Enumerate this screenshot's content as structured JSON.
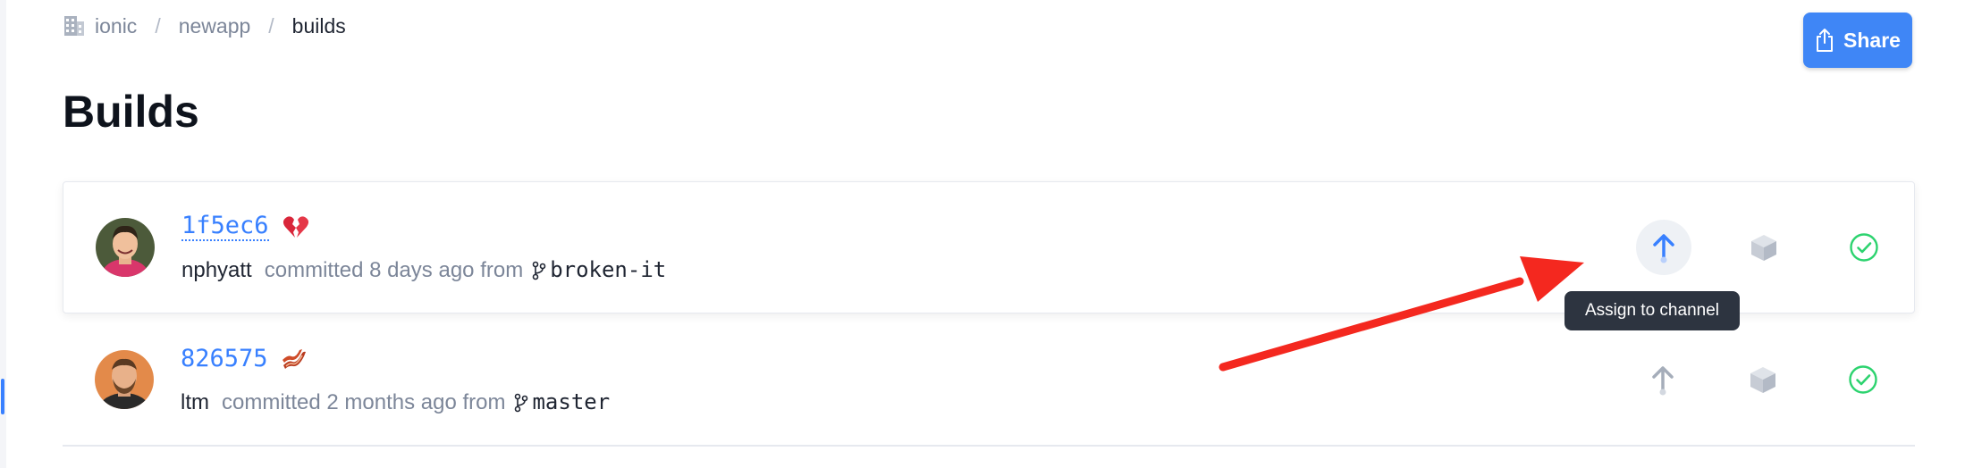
{
  "breadcrumb": {
    "org": "ionic",
    "app": "newapp",
    "current": "builds",
    "separator": "/"
  },
  "header": {
    "share_label": "Share",
    "title": "Builds"
  },
  "builds": [
    {
      "hash": "1f5ec6",
      "emoji": "broken-heart",
      "author": "nphyatt",
      "committed_text": "committed 8 days ago from",
      "branch": "broken-it",
      "status": "success"
    },
    {
      "hash": "826575",
      "emoji": "bacon",
      "author": "ltm",
      "committed_text": "committed 2 months ago from",
      "branch": "master",
      "status": "success"
    }
  ],
  "tooltip": {
    "text": "Assign to channel"
  },
  "icons": {
    "org": "building-icon",
    "share": "share-upload-icon",
    "branch": "git-branch-icon",
    "assign": "arrow-up-icon",
    "package": "package-box-icon",
    "status": "check-circle-icon"
  },
  "colors": {
    "accent": "#3880ff",
    "success": "#2dd36f",
    "annotation_arrow": "#f4281f",
    "tooltip_bg": "#2d3440"
  }
}
